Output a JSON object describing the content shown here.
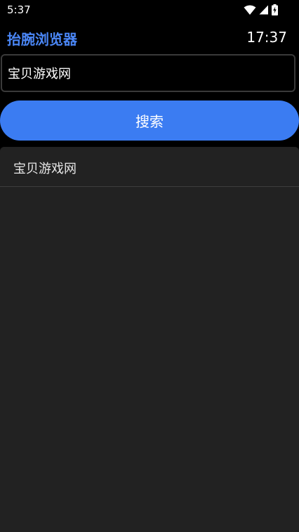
{
  "status_bar": {
    "time": "5:37",
    "icons": [
      "wifi-icon",
      "cell-signal-icon",
      "battery-charging-icon"
    ]
  },
  "header": {
    "title": "抬腕浏览器",
    "clock": "17:37"
  },
  "search": {
    "value": "宝贝游戏网",
    "button_label": "搜索"
  },
  "results": [
    {
      "label": "宝贝游戏网"
    }
  ],
  "colors": {
    "accent": "#4a86f5",
    "button_bg": "#3b7cf2",
    "panel_bg": "#222222",
    "background": "#000000"
  }
}
